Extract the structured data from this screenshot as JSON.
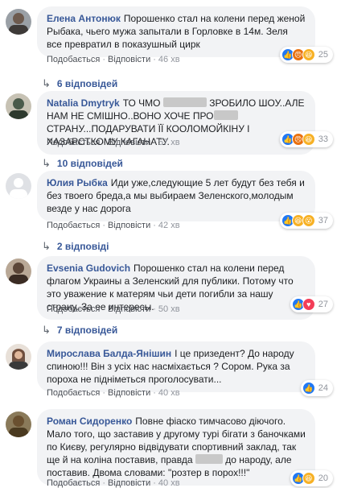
{
  "labels": {
    "like": "Подобається",
    "reply": "Відповісти",
    "sep": "·"
  },
  "comments": [
    {
      "author": "Елена Антонюк",
      "text": "Порошенко стал на колени перед женой Рыбака, чьего мужа запытали в Горловке в 14м. Зеля все превратил в показушный цирк",
      "time": "46 хв",
      "reactions": {
        "icons": [
          "like-icon",
          "angry-icon",
          "haha-icon"
        ],
        "count": "25"
      },
      "replies": "6 відповідей",
      "avatar_color": "#6d5a4e"
    },
    {
      "author": "Natalia Dmytryk",
      "text_before": "ТО ЧМО",
      "text_mid": " ЗРОБИЛО ШОУ..АЛЕ НАМ НЕ СМІШНО..ВОНО ХОЧЕ ПРО",
      "text_after": " СТРАНУ...ПОДАРУВАТИ ЇЇ КООЛОМОЙКІНУ І ХАЗАРСТКОМУ КАГАНАТУ.",
      "time": "57 хв",
      "reactions": {
        "icons": [
          "like-icon",
          "angry-icon",
          "haha-icon"
        ],
        "count": "33"
      },
      "replies": "10 відповідей",
      "avatar_color": "#4a5a4a"
    },
    {
      "author": "Юлия Рыбка",
      "text": "Иди уже,следующие 5 лет будут без тебя и без твоего бреда,а мы выбираем Зеленского,молодым везде у нас дорога",
      "time": "42 хв",
      "reactions": {
        "icons": [
          "like-icon",
          "haha-icon",
          "wow-icon"
        ],
        "count": "37"
      },
      "replies": "2 відповіді",
      "avatar_color": "#c9ccd1"
    },
    {
      "author": "Evsenia Gudovich",
      "text": "Порошенко стал на колени перед флагом Украины а Зеленский для публики. Потому что это уважение к матерям чьи дети погибли за нашу страну. За ее интересы.",
      "time": "50 хв",
      "reactions": {
        "icons": [
          "like-icon",
          "love-icon"
        ],
        "count": "27"
      },
      "replies": "7 відповідей",
      "avatar_color": "#5c4638"
    },
    {
      "author": "Мирослава Балда-Янішин",
      "text": "І це призедент? До народу спиною!!! Він з усіх нас насміхається ? Сором. Рука за пороха не підніметься проголосувати...",
      "time": "40 хв",
      "reactions": {
        "icons": [
          "like-icon"
        ],
        "count": "24"
      },
      "avatar_color": "#8a6a5a"
    },
    {
      "author": "Роман Сидоренко",
      "text_before": "Повне фіаско тимчасово діючого. Мало того, що заставив у другому турі бігати з баночками по Києву, регулярно відвідувати спортивний заклад, так ще й на коліна поставив, правда",
      "text_after": " до народу, але поставив. Двома словами: \"розтер в порох!!!\"",
      "time": "40 хв",
      "reactions": {
        "icons": [
          "like-icon",
          "haha-icon"
        ],
        "count": "20"
      },
      "avatar_color": "#6a5030"
    }
  ]
}
